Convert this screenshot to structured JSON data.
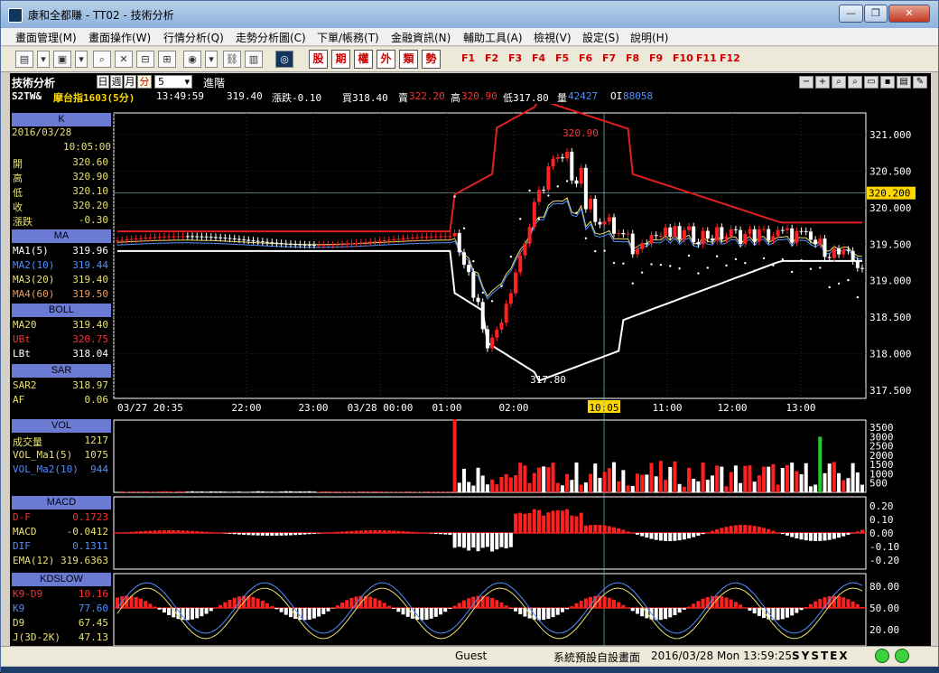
{
  "window": {
    "title": "康和全都賺 - TT02 - 技術分析",
    "minimize_label": "—",
    "restore_label": "❐",
    "close_label": "✕"
  },
  "menu": [
    "畫面管理(M)",
    "畫面操作(W)",
    "行情分析(Q)",
    "走勢分析圖(C)",
    "下單/帳務(T)",
    "金融資訊(N)",
    "輔助工具(A)",
    "檢視(V)",
    "設定(S)",
    "說明(H)"
  ],
  "toolbar": {
    "cn_buttons": [
      "股",
      "期",
      "權",
      "外",
      "類",
      "勢"
    ],
    "fkeys": [
      "F1",
      "F2",
      "F3",
      "F4",
      "F5",
      "F6",
      "F7",
      "F8",
      "F9",
      "F10",
      "F11",
      "F12"
    ]
  },
  "chart_header": {
    "title": "技術分析",
    "period_day": "日",
    "period_week": "週",
    "period_month": "月",
    "period_minute": "分",
    "interval": "5",
    "advanced": "進階"
  },
  "quote": {
    "symbol": "S2TW&",
    "name": "摩台指1603(5分)",
    "time": "13:49:59",
    "price": "319.40",
    "change": "漲跌-0.10",
    "bid": "買318.40",
    "ask_label": "賣",
    "ask": "322.20",
    "high_label": "高",
    "high": "320.90",
    "low": "低317.80",
    "volume_label": "量",
    "volume": "42427",
    "oi_label": "OI",
    "oi": "88058"
  },
  "k_panel": {
    "header": "K",
    "date": "2016/03/28",
    "time": "10:05:00",
    "rows": [
      {
        "label": "開",
        "value": "320.60"
      },
      {
        "label": "高",
        "value": "320.90"
      },
      {
        "label": "低",
        "value": "320.10"
      },
      {
        "label": "收",
        "value": "320.20"
      },
      {
        "label": "漲跌",
        "value": "-0.30"
      }
    ]
  },
  "ma_panel": {
    "header": "MA",
    "rows": [
      {
        "label": "MA1(5)",
        "value": "319.96",
        "color": "#ffffff"
      },
      {
        "label": "MA2(10)",
        "value": "319.44",
        "color": "#4f8fff"
      },
      {
        "label": "MA3(20)",
        "value": "319.40",
        "color": "#e8e070"
      },
      {
        "label": "MA4(60)",
        "value": "319.50",
        "color": "#e8a060"
      }
    ]
  },
  "boll_panel": {
    "header": "BOLL",
    "rows": [
      {
        "label": "MA20",
        "value": "319.40",
        "color": "#e8e070"
      },
      {
        "label": "UBt",
        "value": "320.75",
        "color": "#ff3030"
      },
      {
        "label": "LBt",
        "value": "318.04",
        "color": "#ffffff"
      }
    ]
  },
  "sar_panel": {
    "header": "SAR",
    "rows": [
      {
        "label": "SAR2",
        "value": "318.97",
        "color": "#e8e070"
      },
      {
        "label": "AF",
        "value": "0.06",
        "color": "#e8e070"
      }
    ]
  },
  "vol_panel": {
    "header": "VOL",
    "rows": [
      {
        "label": "成交量",
        "value": "1217",
        "color": "#e8e070"
      },
      {
        "label": "VOL_Ma1(5)",
        "value": "1075",
        "color": "#e8e070"
      },
      {
        "label": "VOL_Ma2(10)",
        "value": "944",
        "color": "#4f8fff"
      }
    ]
  },
  "macd_panel": {
    "header": "MACD",
    "rows": [
      {
        "label": "D-F",
        "value": "0.1723",
        "color": "#ff3030"
      },
      {
        "label": "MACD",
        "value": "-0.0412",
        "color": "#e8e070"
      },
      {
        "label": "DIF",
        "value": "0.1311",
        "color": "#4f8fff"
      },
      {
        "label": "EMA(12)",
        "value": "319.6363",
        "color": "#e8e070"
      }
    ]
  },
  "kd_panel": {
    "header": "KDSLOW",
    "rows": [
      {
        "label": "K9-D9",
        "value": "10.16",
        "color": "#ff3030"
      },
      {
        "label": "K9",
        "value": "77.60",
        "color": "#4f8fff"
      },
      {
        "label": "D9",
        "value": "67.45",
        "color": "#e8e070"
      },
      {
        "label": "J(3D-2K)",
        "value": "47.13",
        "color": "#e8e070"
      }
    ]
  },
  "price_axis": [
    "321.000",
    "320.500",
    "320.000",
    "319.500",
    "319.000",
    "318.500",
    "318.000",
    "317.500"
  ],
  "price_cursor": "320.200",
  "high_annotation": "320.90",
  "low_annotation": "317.80",
  "time_axis": [
    "03/27 20:35",
    "22:00",
    "23:00",
    "03/28 00:00",
    "01:00",
    "02:00",
    "10:05",
    "11:00",
    "12:00",
    "13:00"
  ],
  "vol_axis": [
    "3500",
    "3000",
    "2500",
    "2000",
    "1500",
    "1000",
    "500"
  ],
  "macd_axis": [
    "0.20",
    "0.10",
    "0.00",
    "-0.10",
    "-0.20"
  ],
  "kd_axis": [
    "80.00",
    "50.00",
    "20.00"
  ],
  "status": {
    "user": "Guest",
    "layout": "系統預設自設畫面",
    "datetime": "2016/03/28 Mon 13:59:25",
    "brand": "SYSTEX"
  },
  "colors": {
    "up": "#ff2020",
    "down": "#ffffff",
    "accent_yellow": "#ffd700"
  }
}
